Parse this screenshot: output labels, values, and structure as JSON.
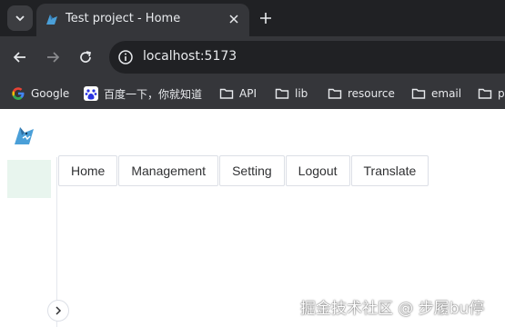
{
  "browser": {
    "tab": {
      "title": "Test project - Home"
    },
    "address_bar": {
      "url": "localhost:5173"
    },
    "bookmarks": [
      {
        "label": "Google",
        "icon": "google-icon"
      },
      {
        "label": "百度一下，你就知道",
        "icon": "baidu-icon"
      },
      {
        "label": "API",
        "icon": "folder-icon"
      },
      {
        "label": "lib",
        "icon": "folder-icon"
      },
      {
        "label": "resource",
        "icon": "folder-icon"
      },
      {
        "label": "email",
        "icon": "folder-icon"
      },
      {
        "label": "p",
        "icon": "folder-icon"
      }
    ]
  },
  "app": {
    "menu": [
      {
        "label": "Home"
      },
      {
        "label": "Management"
      },
      {
        "label": "Setting"
      },
      {
        "label": "Logout"
      },
      {
        "label": "Translate"
      }
    ],
    "colors": {
      "accent_light": "#e8f5ee",
      "border": "#dcdfe6",
      "text": "#303133"
    }
  },
  "watermark": "掘金技术社区 @ 步履bu停"
}
